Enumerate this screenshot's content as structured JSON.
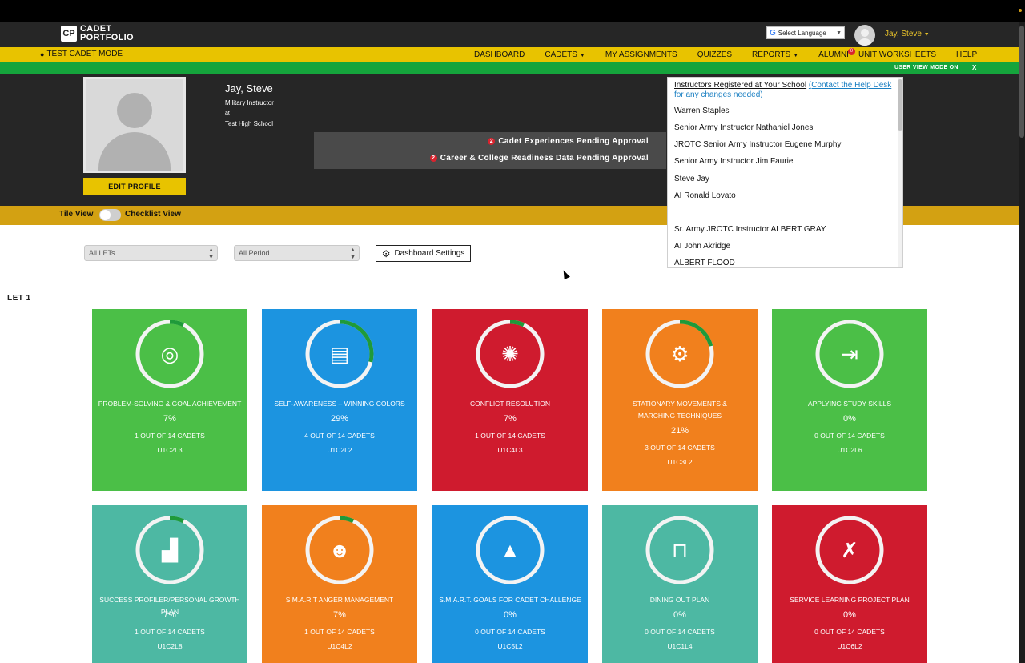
{
  "header": {
    "logo_mark": "CP",
    "logo_line1": "CADET",
    "logo_line2": "PORTFOLIO",
    "language_select": "Select Language",
    "user_name": "Jay, Steve"
  },
  "nav": {
    "test_mode": "TEST CADET MODE",
    "items": [
      {
        "label": "DASHBOARD"
      },
      {
        "label": "CADETS"
      },
      {
        "label": "MY ASSIGNMENTS"
      },
      {
        "label": "QUIZZES"
      },
      {
        "label": "REPORTS"
      },
      {
        "label": "ALUMNI",
        "badge": "0"
      },
      {
        "label": "UNIT WORKSHEETS"
      },
      {
        "label": "HELP"
      }
    ],
    "user_view_mode": "USER VIEW MODE ON",
    "user_view_close": "X"
  },
  "profile": {
    "name": "Jay, Steve",
    "role": "Military Instructor",
    "at": "at",
    "school": "Test High School",
    "edit_button": "EDIT PROFILE",
    "pending": [
      {
        "count": "2",
        "label": "Cadet Experiences Pending Approval"
      },
      {
        "count": "2",
        "label": "Career & College Readiness Data Pending Approval"
      }
    ]
  },
  "instructors": {
    "title": "Instructors Registered at Your School",
    "link": "(Contact the Help Desk for any changes needed)",
    "list": [
      "Warren Staples",
      "Senior Army Instructor Nathaniel Jones",
      "JROTC Senior Army Instructor Eugene Murphy",
      "Senior Army Instructor Jim Faurie",
      "Steve Jay",
      "AI Ronald Lovato",
      "",
      "Sr. Army JROTC Instructor ALBERT GRAY",
      "AI John Akridge",
      "ALBERT FLOOD"
    ]
  },
  "view_toggle": {
    "left": "Tile View",
    "right": "Checklist View"
  },
  "filters": {
    "lets": "All LETs",
    "period": "All Period",
    "settings": "Dashboard Settings"
  },
  "section_label": "LET 1",
  "tiles": [
    {
      "name": "PROBLEM-SOLVING & GOAL ACHIEVEMENT",
      "pct": "7%",
      "progress": 0.07,
      "count": "1 OUT OF 14 CADETS",
      "code": "U1C2L3",
      "color": "#4bbf47",
      "icon": "target-icon"
    },
    {
      "name": "SELF-AWARENESS – WINNING COLORS",
      "pct": "29%",
      "progress": 0.29,
      "count": "4 OUT OF 14 CADETS",
      "code": "U1C2L2",
      "color": "#1c94e0",
      "icon": "document-icon"
    },
    {
      "name": "CONFLICT RESOLUTION",
      "pct": "7%",
      "progress": 0.07,
      "count": "1 OUT OF 14 CADETS",
      "code": "U1C4L3",
      "color": "#cf1b2e",
      "icon": "lightbulb-icon"
    },
    {
      "name": "STATIONARY MOVEMENTS & MARCHING TECHNIQUES",
      "pct": "21%",
      "progress": 0.21,
      "count": "3 OUT OF 14 CADETS",
      "code": "U1C3L2",
      "color": "#f1801d",
      "icon": "gears-icon"
    },
    {
      "name": "APPLYING STUDY SKILLS",
      "pct": "0%",
      "progress": 0,
      "count": "0 OUT OF 14 CADETS",
      "code": "U1C2L6",
      "color": "#4bbf47",
      "icon": "sign-in-icon"
    },
    {
      "name": "SUCCESS PROFILER/PERSONAL GROWTH PLAN",
      "pct": "7%",
      "progress": 0.07,
      "count": "1 OUT OF 14 CADETS",
      "code": "U1C2L8",
      "color": "#4db8a3",
      "icon": "growth-chart-icon"
    },
    {
      "name": "S.M.A.R.T ANGER MANAGEMENT",
      "pct": "7%",
      "progress": 0.07,
      "count": "1 OUT OF 14 CADETS",
      "code": "U1C4L2",
      "color": "#f1801d",
      "icon": "head-icon"
    },
    {
      "name": "S.M.A.R.T. GOALS FOR CADET CHALLENGE",
      "pct": "0%",
      "progress": 0,
      "count": "0 OUT OF 14 CADETS",
      "code": "U1C5L2",
      "color": "#1c94e0",
      "icon": "mountain-flag-icon"
    },
    {
      "name": "DINING OUT PLAN",
      "pct": "0%",
      "progress": 0,
      "count": "0 OUT OF 14 CADETS",
      "code": "U1C1L4",
      "color": "#4db8a3",
      "icon": "dining-table-icon"
    },
    {
      "name": "SERVICE LEARNING PROJECT PLAN",
      "pct": "0%",
      "progress": 0,
      "count": "0 OUT OF 14 CADETS",
      "code": "U1C6L2",
      "color": "#cf1b2e",
      "icon": "strategy-map-icon"
    }
  ]
}
